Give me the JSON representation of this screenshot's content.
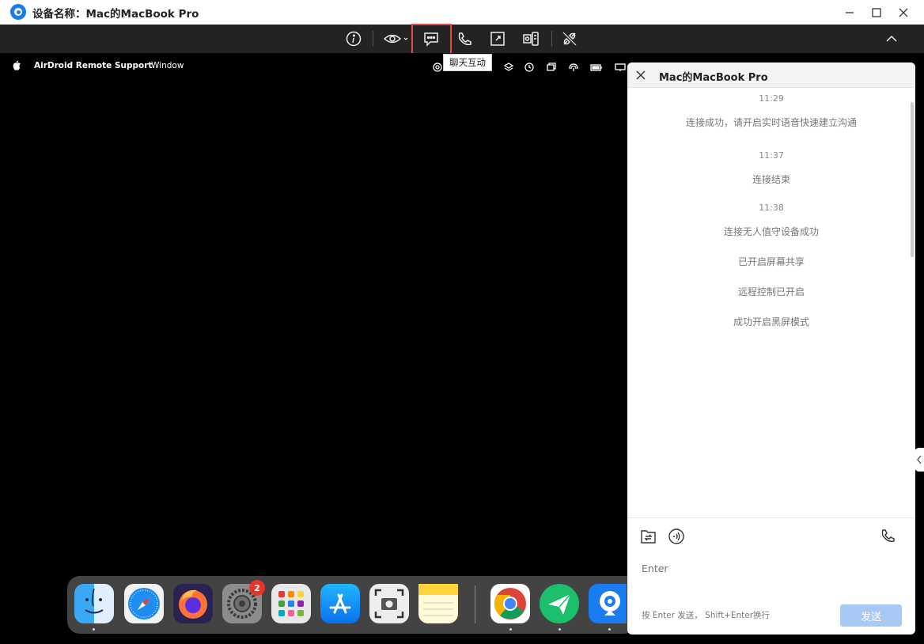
{
  "window": {
    "title": "设备名称：Mac的MacBook Pro",
    "controls": [
      "minimize-icon",
      "maximize-icon",
      "close-icon"
    ]
  },
  "toolbar": {
    "buttons": [
      {
        "name": "info",
        "icon": "info-icon"
      },
      {
        "name": "view",
        "icon": "eye-icon"
      },
      {
        "name": "chat",
        "icon": "chat-bubble-icon",
        "active": true
      },
      {
        "name": "voice-call",
        "icon": "phone-icon"
      },
      {
        "name": "fullscreen",
        "icon": "expand-icon"
      },
      {
        "name": "device-tools",
        "icon": "device-icon"
      },
      {
        "name": "disconnect",
        "icon": "disconnect-icon"
      },
      {
        "name": "collapse",
        "icon": "chevron-up-icon"
      }
    ],
    "tooltip": "聊天互动",
    "highlight_color": "#e84a4a"
  },
  "remote_menubar": {
    "app_name": "AirDroid Remote Support",
    "items": [
      "Window"
    ]
  },
  "dock": {
    "apps": [
      "Finder",
      "Safari",
      "Firefox",
      "System Settings",
      "Launchpad",
      "App Store",
      "Screenshot",
      "Notes",
      "Chrome",
      "AirDroid Remote Support",
      "AirDroid"
    ],
    "settings_badge": "2"
  },
  "chat": {
    "title": "Mac的MacBook Pro",
    "messages": [
      {
        "time": "11:29",
        "lines": [
          "连接成功，请开启实时语音快速建立沟通"
        ]
      },
      {
        "time": "11:37",
        "lines": [
          "连接结束"
        ]
      },
      {
        "time": "11:38",
        "lines": [
          "连接无人值守设备成功",
          "已开启屏幕共享",
          "远程控制已开启",
          "成功开启黑屏模式"
        ]
      }
    ],
    "input_placeholder": "Enter",
    "hint": "按 Enter 发送， Shift+Enter换行",
    "send_label": "发送",
    "send_color": "#a9c9f5"
  }
}
